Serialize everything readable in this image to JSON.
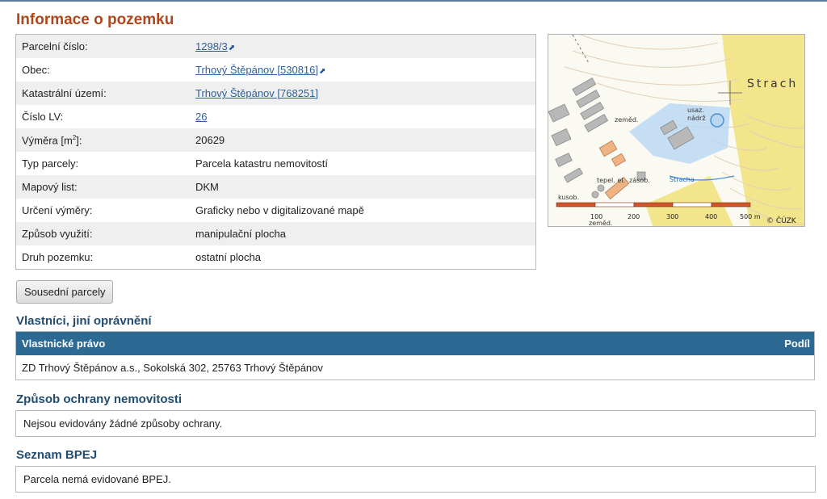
{
  "page": {
    "title": "Informace o pozemku"
  },
  "info_rows": [
    {
      "label": "Parcelní číslo:",
      "value": "1298/3",
      "link": true,
      "external": true
    },
    {
      "label": "Obec:",
      "value": "Trhový Štěpánov [530816]",
      "link": true,
      "external": true
    },
    {
      "label": "Katastrální území:",
      "value": "Trhový Štěpánov [768251]",
      "link": true,
      "external": false
    },
    {
      "label": "Číslo LV:",
      "value": "26",
      "link": true,
      "external": false
    },
    {
      "label": "Výměra [m",
      "label_sup": "2",
      "label_tail": "]:",
      "value": "20629",
      "link": false
    },
    {
      "label": "Typ parcely:",
      "value": "Parcela katastru nemovitostí",
      "link": false
    },
    {
      "label": "Mapový list:",
      "value": "DKM",
      "link": false
    },
    {
      "label": "Určení výměry:",
      "value": "Graficky nebo v digitalizované mapě",
      "link": false
    },
    {
      "label": "Způsob využití:",
      "value": "manipulační plocha",
      "link": false
    },
    {
      "label": "Druh pozemku:",
      "value": "ostatní plocha",
      "link": false
    }
  ],
  "neighbors_button": "Sousední parcely",
  "owners": {
    "heading": "Vlastníci, jiní oprávnění",
    "col_right": "Vlastnické právo",
    "col_share": "Podíl",
    "rows": [
      "ZD Trhový Štěpánov a.s., Sokolská 302, 25763 Trhový Štěpánov"
    ]
  },
  "protection": {
    "heading": "Způsob ochrany nemovitosti",
    "text": "Nejsou evidovány žádné způsoby ochrany."
  },
  "bpej": {
    "heading": "Seznam BPEJ",
    "text": "Parcela nemá evidované BPEJ."
  },
  "map": {
    "labels": {
      "place": "Strach",
      "usaz": "usaz.",
      "nadrz": "nádrž",
      "zemed1": "zeměd.",
      "zemed2": "zeměd.",
      "tepel": "tepel. el.",
      "zasob": "zásob.",
      "stream": "Stracha",
      "kusob": "kusob."
    },
    "scale_ticks": [
      "100",
      "200",
      "300",
      "400",
      "500 m"
    ],
    "copyright": "© ČÚZK"
  }
}
